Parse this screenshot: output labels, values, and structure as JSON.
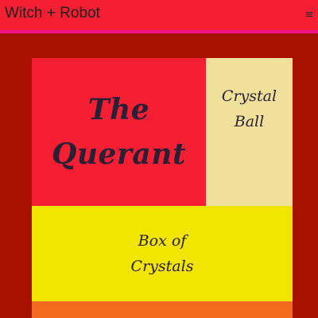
{
  "header": {
    "title": "Witch + Robot",
    "menu_icon": "hamburger-menu-icon",
    "menu_glyph": "≡"
  },
  "tiles": {
    "querant": {
      "line1": "The",
      "line2": "Querant"
    },
    "crystal_ball": {
      "line1": "Crystal",
      "line2": "Ball"
    },
    "box_of_crystals": {
      "line1": "Box of",
      "line2": "Crystals"
    }
  },
  "colors": {
    "background": "#a81100",
    "header": "#f51f34",
    "header_border": "#ee1188",
    "querant": "#f51f34",
    "crystal_ball": "#f0e19a",
    "box_of_crystals": "#f2e500",
    "bottom_tile": "#f26a1e",
    "text": "#2a2036"
  }
}
